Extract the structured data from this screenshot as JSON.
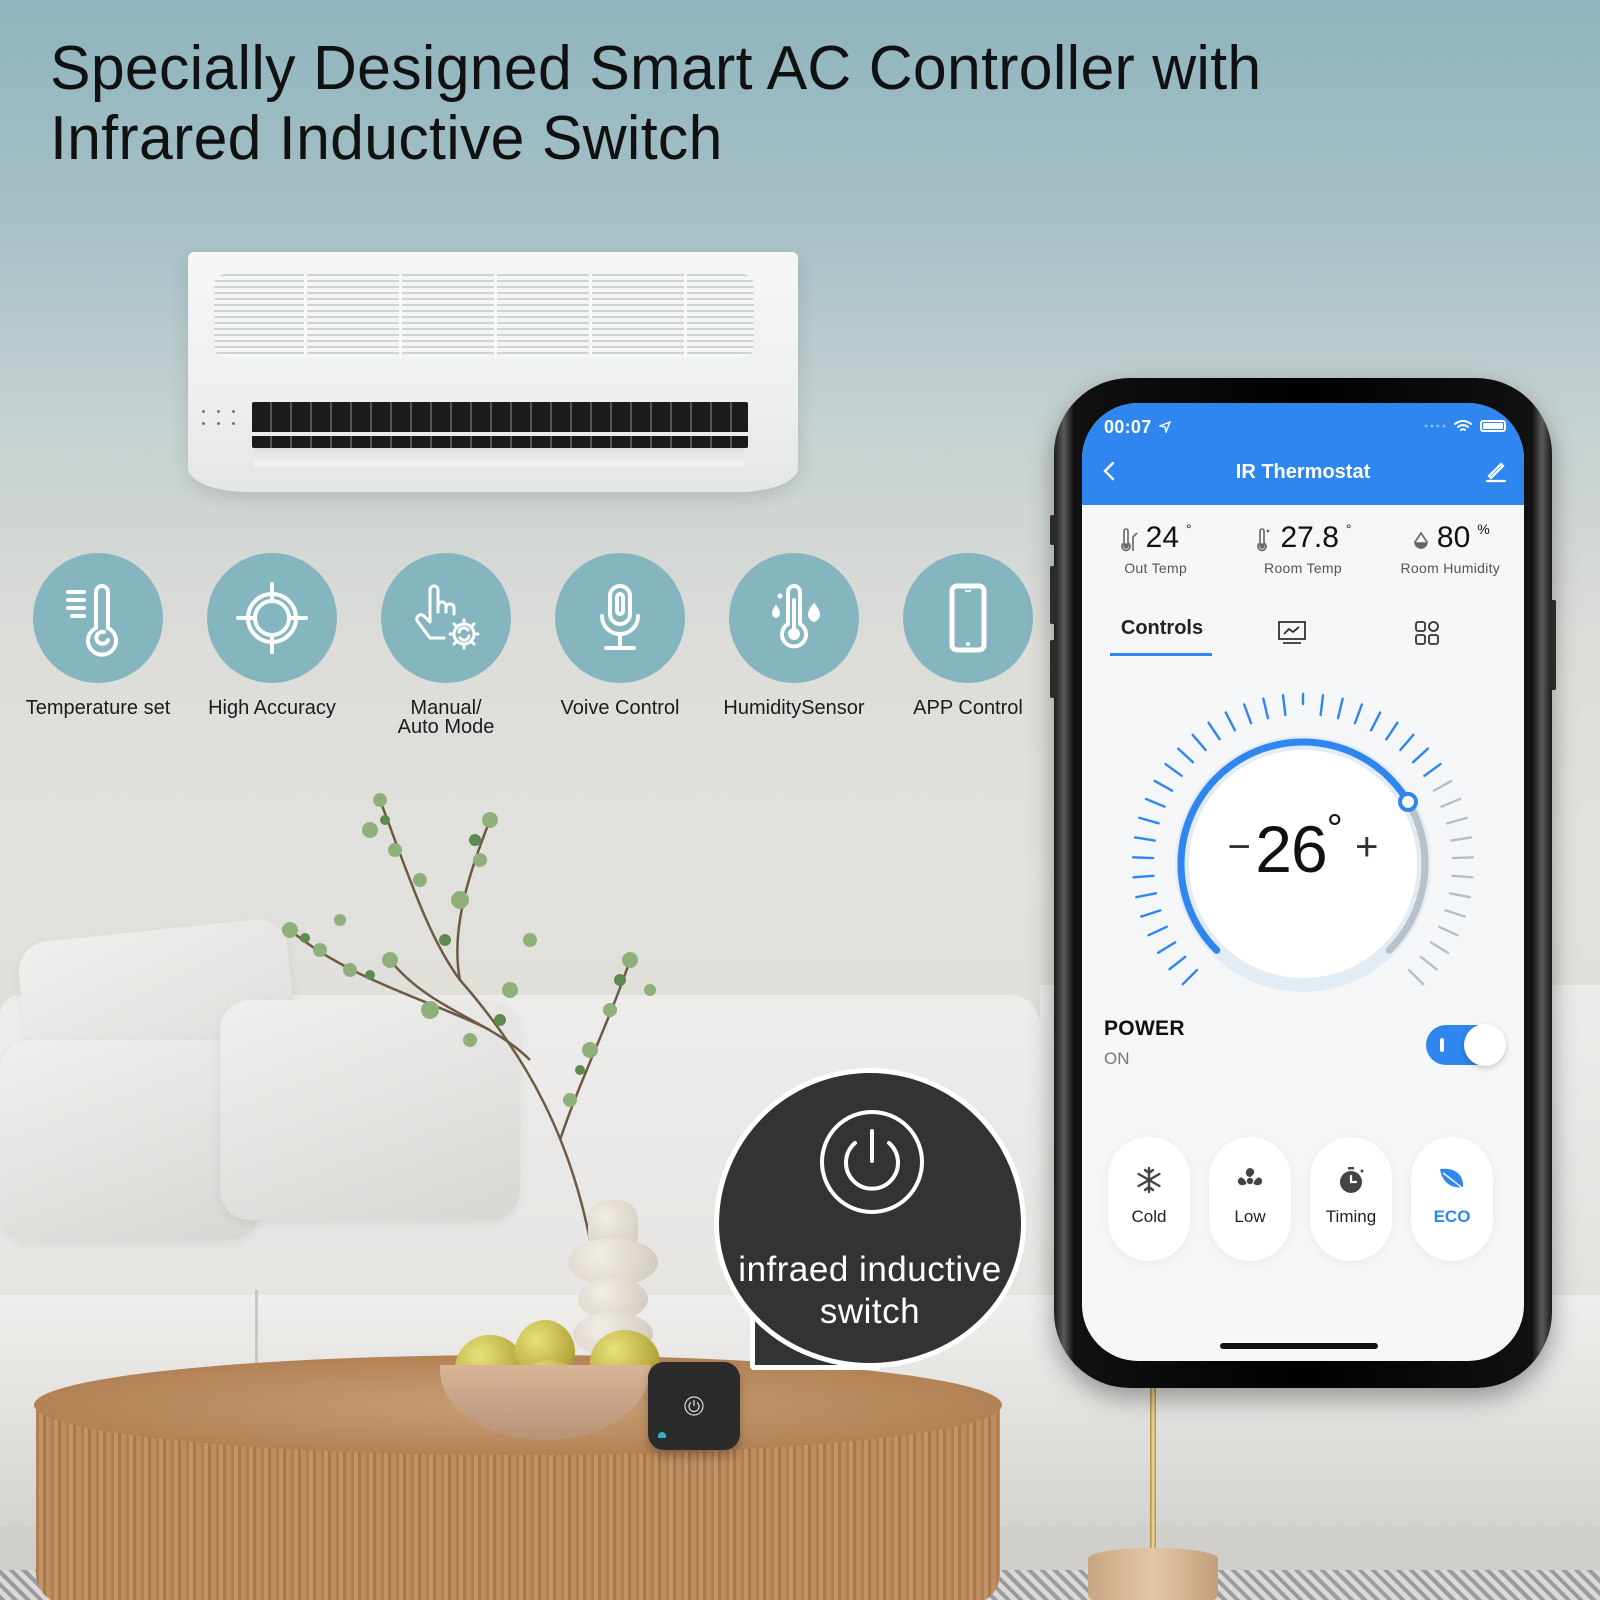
{
  "headline": {
    "line1": "Specially Designed Smart AC Controller with",
    "line2": "Infrared Inductive Switch"
  },
  "features": [
    {
      "label": "Temperature set",
      "icon": "thermometer-icon"
    },
    {
      "label": "High Accuracy",
      "icon": "crosshair-icon"
    },
    {
      "label": "Manual/\nAuto Mode",
      "label_line1": "Manual/",
      "label_line2": "Auto Mode",
      "icon": "hand-gear-icon"
    },
    {
      "label": "Voive Control",
      "icon": "microphone-icon"
    },
    {
      "label": "HumiditySensor",
      "icon": "thermometer-droplet-icon"
    },
    {
      "label": "APP Control",
      "icon": "smartphone-icon"
    }
  ],
  "callout": {
    "line1": "infraed inductive",
    "line2": "switch",
    "icon": "power-icon"
  },
  "phone": {
    "status_bar": {
      "time": "00:07",
      "location_icon": "location-arrow-icon",
      "wifi_icon": "wifi-icon",
      "battery_icon": "battery-icon"
    },
    "app": {
      "title": "IR Thermostat",
      "back_icon": "chevron-left-icon",
      "edit_icon": "pencil-icon",
      "stats": [
        {
          "value": "24",
          "unit": "°",
          "label": "Out Temp",
          "icon": "outdoor-thermometer-icon"
        },
        {
          "value": "27.8",
          "unit": "°",
          "label": "Room Temp",
          "icon": "thermometer-icon"
        },
        {
          "value": "80",
          "unit": "%",
          "label": "Room Humidity",
          "icon": "droplet-icon"
        }
      ],
      "tabs": [
        {
          "label": "Controls",
          "active": true
        },
        {
          "icon": "chart-icon",
          "active": false
        },
        {
          "icon": "grid-icon",
          "active": false
        }
      ],
      "dial": {
        "set_temp": "26",
        "unit": "°",
        "minus": "−",
        "plus": "+",
        "fraction": 0.72
      },
      "power": {
        "label": "POWER",
        "state": "ON",
        "on": true
      },
      "modes": [
        {
          "label": "Cold",
          "icon": "snowflake-icon",
          "active": false
        },
        {
          "label": "Low",
          "icon": "fan-icon",
          "active": false
        },
        {
          "label": "Timing",
          "icon": "stopwatch-icon",
          "active": false
        },
        {
          "label": "ECO",
          "icon": "leaf-icon",
          "active": true
        }
      ]
    }
  },
  "colors": {
    "accent_blue": "#2e86ee",
    "feature_circle": "#85b5bf",
    "callout_bg": "#333333"
  }
}
